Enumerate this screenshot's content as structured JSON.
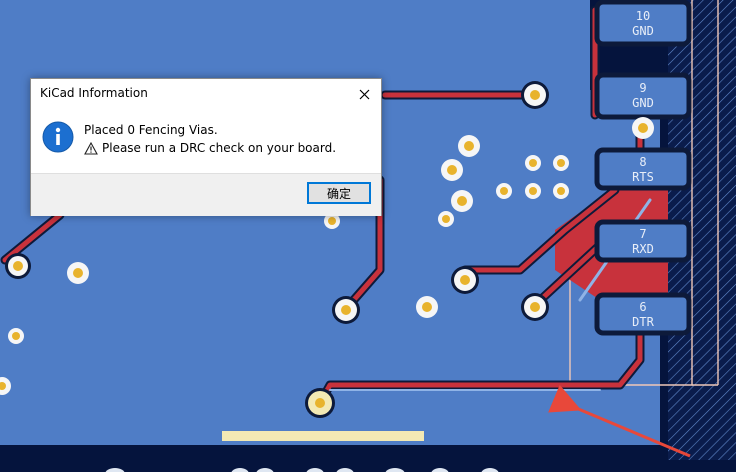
{
  "dialog": {
    "title": "KiCad Information",
    "message_line1": "Placed 0 Fencing Vias.",
    "message_line2": "Please run a DRC check on your board.",
    "ok_label": "确定"
  },
  "icons": {
    "info": "info-icon",
    "warning": "warning-icon",
    "close": "close-icon"
  },
  "pcb": {
    "pads": [
      {
        "number": "10",
        "name": "GND"
      },
      {
        "number": "9",
        "name": "GND"
      },
      {
        "number": "8",
        "name": "RTS"
      },
      {
        "number": "7",
        "name": "RXD"
      },
      {
        "number": "6",
        "name": "DTR"
      }
    ]
  },
  "colors": {
    "board_background": "#05143d",
    "copper_pour": "#4f7dc6",
    "front_copper": "#c8323c",
    "pad_outline": "#0d1a3a",
    "via_center": "#e8b32d",
    "annotation_arrow": "#e8483a"
  }
}
